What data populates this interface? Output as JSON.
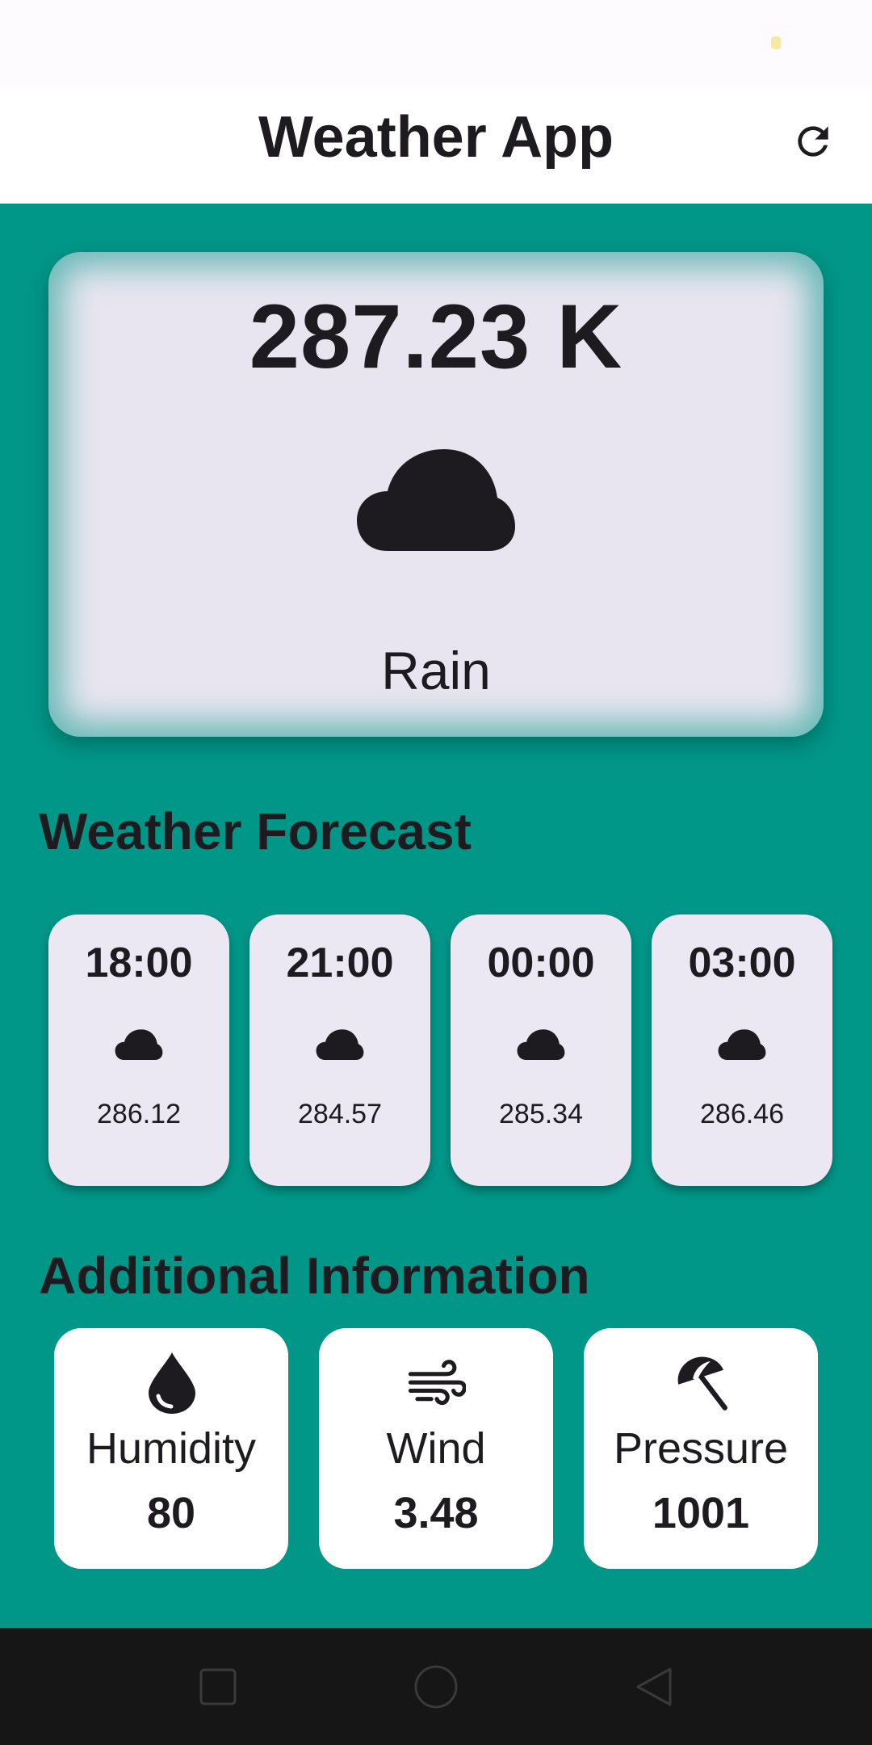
{
  "app_bar": {
    "title": "Weather App",
    "refresh_icon": "refresh-icon"
  },
  "current": {
    "temperature": "287.23 K",
    "icon": "cloud-icon",
    "description": "Rain"
  },
  "forecast": {
    "title": "Weather Forecast",
    "items": [
      {
        "time": "18:00",
        "icon": "cloud-icon",
        "temp": "286.12"
      },
      {
        "time": "21:00",
        "icon": "cloud-icon",
        "temp": "284.57"
      },
      {
        "time": "00:00",
        "icon": "cloud-icon",
        "temp": "285.34"
      },
      {
        "time": "03:00",
        "icon": "cloud-icon",
        "temp": "286.46"
      }
    ]
  },
  "additional": {
    "title": "Additional Information",
    "items": [
      {
        "label": "Humidity",
        "value": "80",
        "icon": "water-drop-icon"
      },
      {
        "label": "Wind",
        "value": "3.48",
        "icon": "wind-icon"
      },
      {
        "label": "Pressure",
        "value": "1001",
        "icon": "umbrella-icon"
      }
    ]
  },
  "colors": {
    "background": "#009688",
    "card": "#e8e5f0",
    "text": "#1d1b20",
    "nav_bar": "#161616"
  },
  "nav_bar": {
    "buttons": [
      "recents-icon",
      "home-icon",
      "back-icon"
    ]
  }
}
